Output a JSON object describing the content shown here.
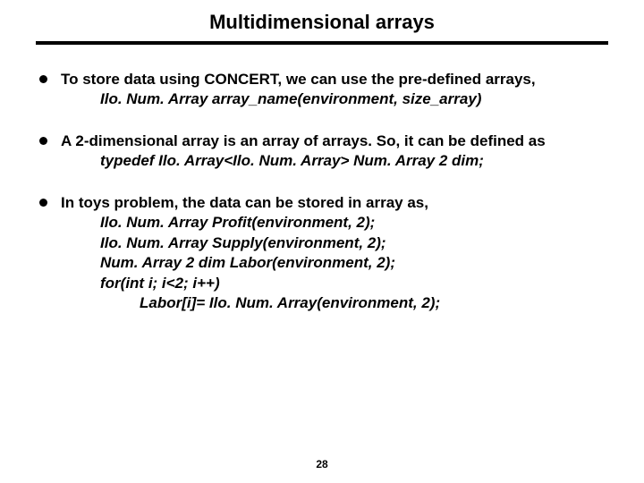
{
  "title": "Multidimensional arrays",
  "bullets": [
    {
      "lead": "To store data using CONCERT, we can use the pre-defined arrays,",
      "code1": "Ilo. Num. Array  array_name(environment, size_array)"
    },
    {
      "lead": "A 2-dimensional array is an array of arrays. So, it can be defined as",
      "code1": "typedef Ilo. Array<Ilo. Num. Array>   Num. Array 2 dim;"
    },
    {
      "lead": "In toys problem, the data can be stored in array as,",
      "code1": "Ilo. Num. Array Profit(environment, 2);",
      "code2": "Ilo. Num. Array Supply(environment, 2);",
      "code3": "Num. Array 2 dim Labor(environment, 2);",
      "code4": "for(int i; i<2; i++)",
      "code5": "Labor[i]= Ilo. Num. Array(environment, 2);"
    }
  ],
  "page_number": "28"
}
